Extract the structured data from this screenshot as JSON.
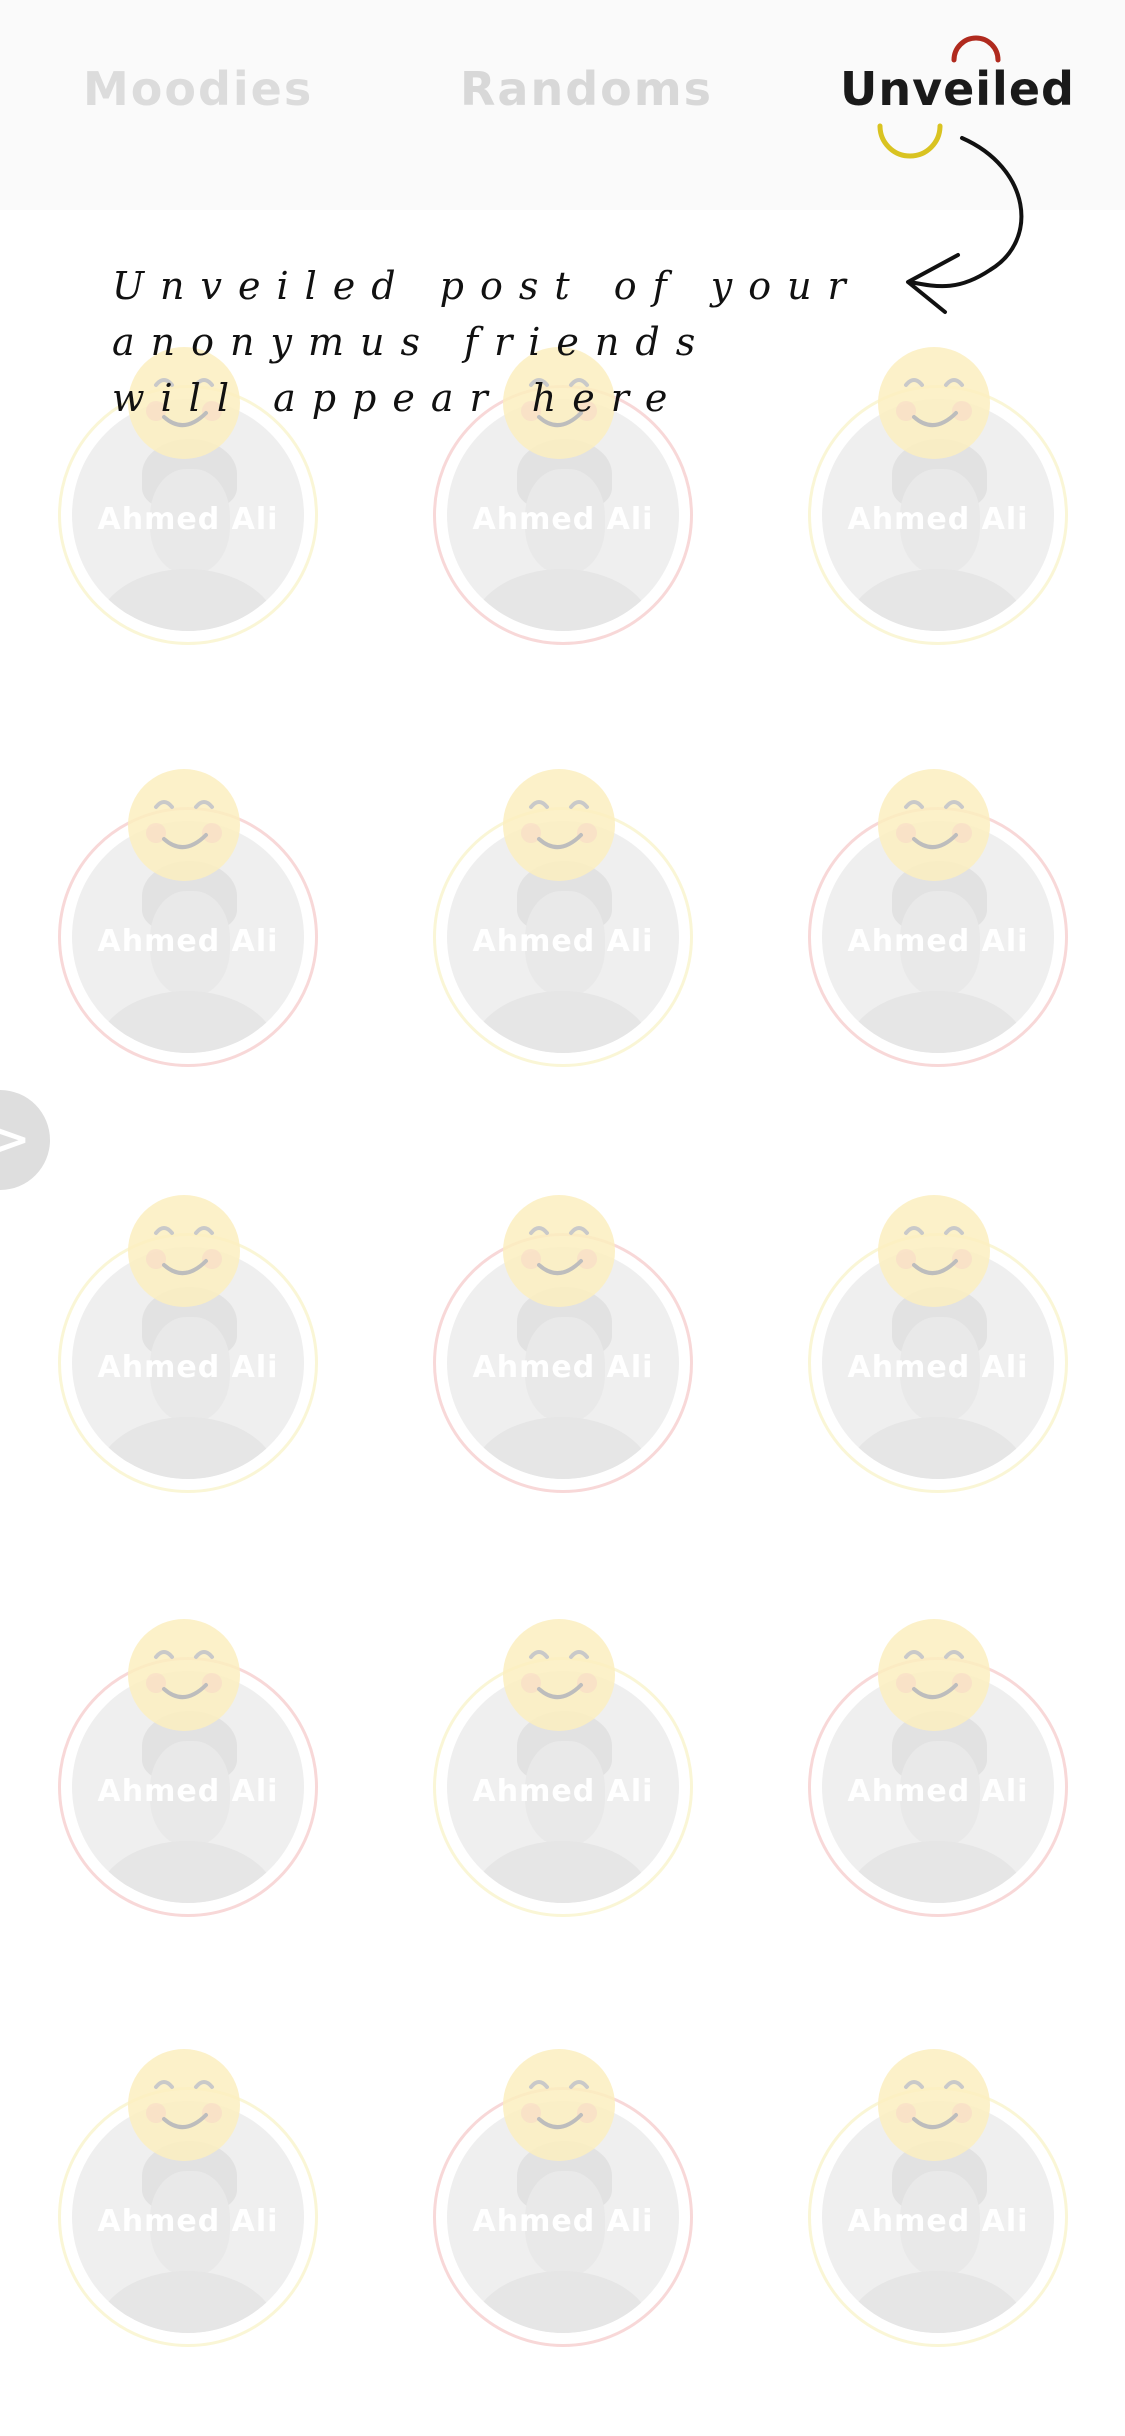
{
  "tabs": [
    {
      "label": "Moodies"
    },
    {
      "label": "Randoms"
    },
    {
      "label": "Unveiled"
    }
  ],
  "active_tab": "Unveiled",
  "hint_text": "Unveiled post of your anonymus friends will appear here",
  "side_button": {
    "label": ">"
  },
  "colors": {
    "ring_red": "#f2b8b8",
    "ring_yellow": "#f6efb5",
    "emoji": "#fbeec0",
    "tab_active": "#1a1a1a",
    "tab_inactive": "#dcdcdc"
  },
  "profiles": [
    {
      "name": "Ahmed Ali",
      "ring": "yellow"
    },
    {
      "name": "Ahmed Ali",
      "ring": "red"
    },
    {
      "name": "Ahmed Ali",
      "ring": "yellow"
    },
    {
      "name": "Ahmed Ali",
      "ring": "red"
    },
    {
      "name": "Ahmed Ali",
      "ring": "yellow"
    },
    {
      "name": "Ahmed Ali",
      "ring": "red"
    },
    {
      "name": "Ahmed Ali",
      "ring": "yellow"
    },
    {
      "name": "Ahmed Ali",
      "ring": "red"
    },
    {
      "name": "Ahmed Ali",
      "ring": "yellow"
    },
    {
      "name": "Ahmed Ali",
      "ring": "red"
    },
    {
      "name": "Ahmed Ali",
      "ring": "yellow"
    },
    {
      "name": "Ahmed Ali",
      "ring": "red"
    },
    {
      "name": "Ahmed Ali",
      "ring": "yellow"
    },
    {
      "name": "Ahmed Ali",
      "ring": "red"
    },
    {
      "name": "Ahmed Ali",
      "ring": "yellow"
    }
  ]
}
